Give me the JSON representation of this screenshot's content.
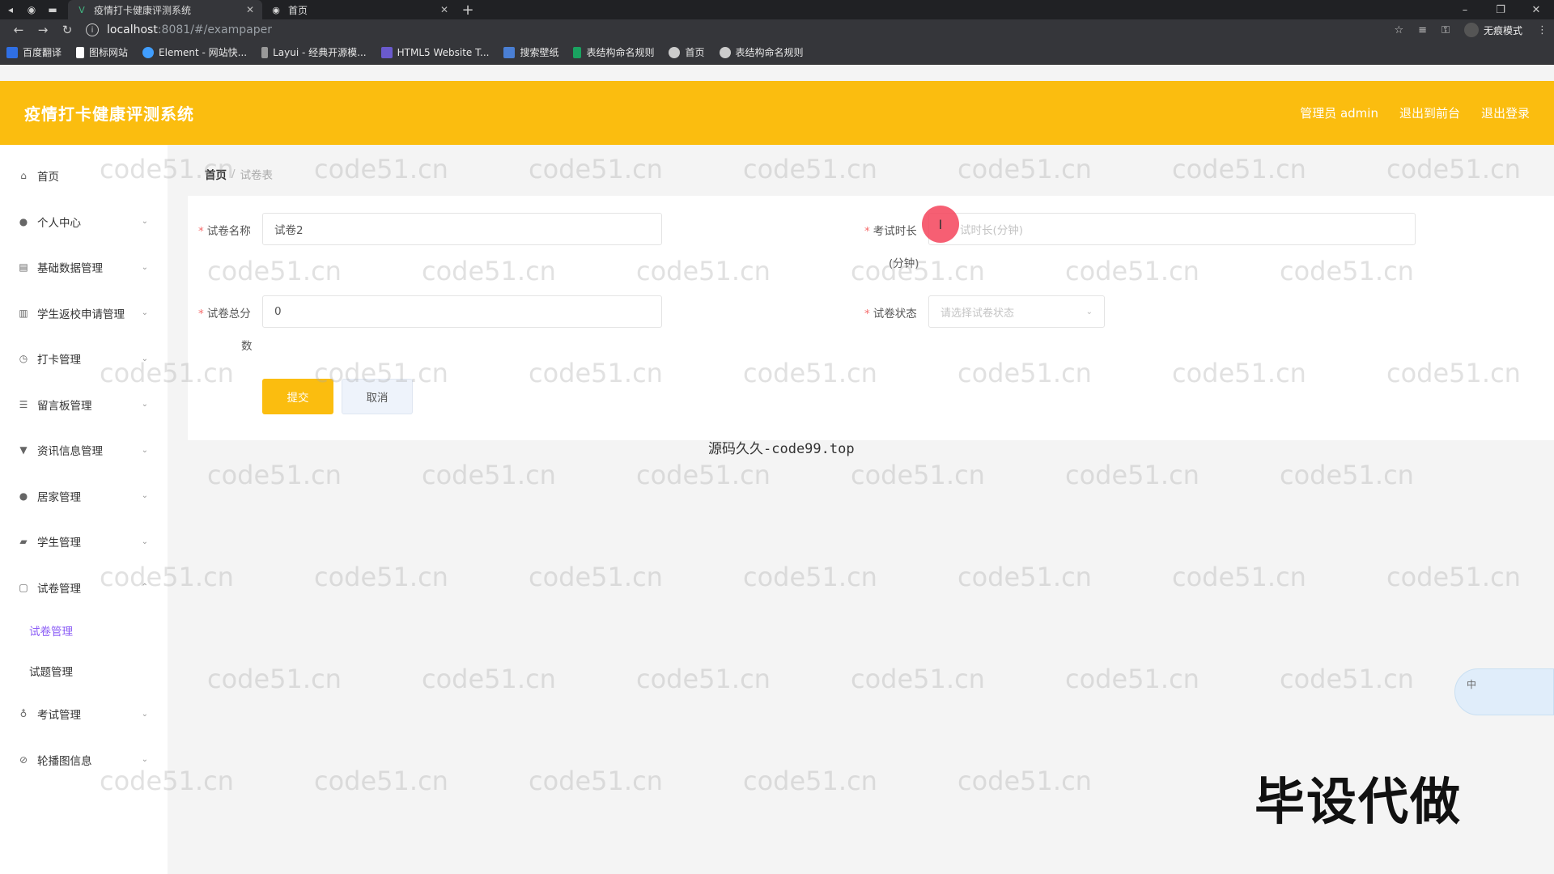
{
  "browser": {
    "tabs": [
      {
        "title": "疫情打卡健康评测系统",
        "active": true
      },
      {
        "title": "首页",
        "active": false
      }
    ],
    "url_host": "localhost",
    "url_rest": ":8081/#/exampaper",
    "incognito_label": "无痕模式",
    "bookmarks": [
      "百度翻译",
      "图标网站",
      "Element - 网站快...",
      "Layui - 经典开源模...",
      "HTML5 Website T...",
      "搜索壁纸",
      "表结构命名规则",
      "首页",
      "表结构命名规则"
    ]
  },
  "header": {
    "title": "疫情打卡健康评测系统",
    "user_label": "管理员 admin",
    "front_link": "退出到前台",
    "logout_link": "退出登录",
    "accent_color": "#fbbd0f"
  },
  "sidebar": {
    "items": [
      {
        "label": "首页",
        "icon": "home-icon"
      },
      {
        "label": "个人中心",
        "icon": "user-icon"
      },
      {
        "label": "基础数据管理",
        "icon": "table-icon"
      },
      {
        "label": "学生返校申请管理",
        "icon": "chart-icon"
      },
      {
        "label": "打卡管理",
        "icon": "clock-icon"
      },
      {
        "label": "留言板管理",
        "icon": "list-icon"
      },
      {
        "label": "资讯信息管理",
        "icon": "news-icon"
      },
      {
        "label": "居家管理",
        "icon": "user-icon"
      },
      {
        "label": "学生管理",
        "icon": "student-icon"
      },
      {
        "label": "试卷管理",
        "icon": "folder-icon"
      },
      {
        "label": "考试管理",
        "icon": "mic-icon"
      },
      {
        "label": "轮播图信息",
        "icon": "image-icon"
      }
    ],
    "sub_items": [
      {
        "label": "试卷管理",
        "active": true
      },
      {
        "label": "试题管理",
        "active": false
      }
    ]
  },
  "breadcrumb": {
    "home": "首页",
    "separator": "/",
    "current": "试卷表"
  },
  "form": {
    "name_label": "试卷名称",
    "name_value": "试卷2",
    "duration_label": "考试时长",
    "duration_placeholder": "试时长(分钟)",
    "duration_unit": "(分钟)",
    "score_label": "试卷总分",
    "score_label_cont": "数",
    "score_value": "0",
    "status_label": "试卷状态",
    "status_placeholder": "请选择试卷状态",
    "submit_label": "提交",
    "cancel_label": "取消"
  },
  "overlay": {
    "watermark_text": "code51.cn",
    "source_note": "源码久久-code99.top",
    "big_text": "毕设代做",
    "widget_text": "中"
  }
}
